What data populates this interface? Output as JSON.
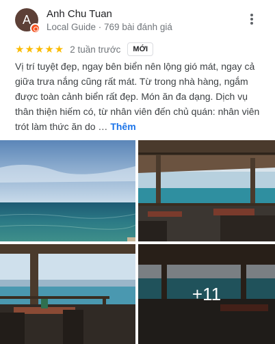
{
  "author": {
    "initial": "A",
    "name": "Anh Chu Tuan",
    "meta": "Local Guide · 769 bài đánh giá"
  },
  "rating": {
    "stars": "★★★★★",
    "value": 5,
    "time": "2 tuần trước",
    "badge": "MỚI"
  },
  "review": {
    "text": "Vị trí tuyệt đẹp, ngay bên biển nên lộng gió mát, ngay cả giữa trưa nắng cũng rất mát. Từ trong nhà hàng, ngắm được toàn cảnh biển rất đẹp. Món ăn đa dạng. Dịch vụ thân thiện hiếm có, từ nhân viên đến chủ quán: nhân viên trót làm thức ăn do …",
    "more_label": "Thêm"
  },
  "photos": {
    "extra_count": "+11"
  },
  "colors": {
    "star": "#fbbc04",
    "link": "#1a73e8",
    "avatar_bg": "#5d4037",
    "guide_badge": "#f4511e"
  },
  "icons": [
    "more-vert-icon",
    "local-guide-badge-icon",
    "star-icon"
  ]
}
